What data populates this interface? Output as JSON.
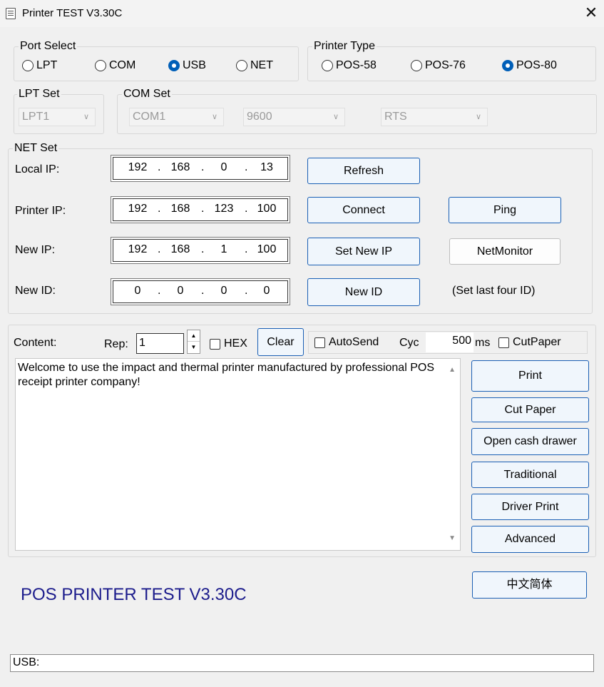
{
  "window": {
    "title": "Printer TEST V3.30C",
    "close": "✕"
  },
  "port_select": {
    "label": "Port Select",
    "options": [
      {
        "label": "LPT",
        "selected": false
      },
      {
        "label": "COM",
        "selected": false
      },
      {
        "label": "USB",
        "selected": true
      },
      {
        "label": "NET",
        "selected": false
      }
    ]
  },
  "printer_type": {
    "label": "Printer Type",
    "options": [
      {
        "label": "POS-58",
        "selected": false
      },
      {
        "label": "POS-76",
        "selected": false
      },
      {
        "label": "POS-80",
        "selected": true
      }
    ]
  },
  "lpt_set": {
    "label": "LPT Set",
    "value": "LPT1"
  },
  "com_set": {
    "label": "COM Set",
    "port": "COM1",
    "baud": "9600",
    "flow": "RTS"
  },
  "net_set": {
    "label": "NET Set",
    "local_ip": {
      "label": "Local IP:",
      "octets": [
        "192",
        "168",
        "0",
        "13"
      ]
    },
    "printer_ip": {
      "label": "Printer IP:",
      "octets": [
        "192",
        "168",
        "123",
        "100"
      ]
    },
    "new_ip": {
      "label": "New IP:",
      "octets": [
        "192",
        "168",
        "1",
        "100"
      ]
    },
    "new_id": {
      "label": "New ID:",
      "octets": [
        "0",
        "0",
        "0",
        "0"
      ]
    },
    "dot": ".",
    "buttons": {
      "refresh": "Refresh",
      "connect": "Connect",
      "ping": "Ping",
      "set_new_ip": "Set New IP",
      "netmonitor": "NetMonitor",
      "new_id": "New ID"
    },
    "hint": "(Set last four ID)"
  },
  "content": {
    "label": "Content:",
    "rep_label": "Rep:",
    "rep_value": "1",
    "hex_label": "HEX",
    "clear_label": "Clear",
    "autosend_label": "AutoSend",
    "cyc_label": "Cyc",
    "cyc_value": "500",
    "ms_label": "ms",
    "cutpaper_label": "CutPaper",
    "text": "Welcome to use the impact and thermal printer manufactured by professional POS receipt printer company!"
  },
  "actions": {
    "print": "Print",
    "cut_paper": "Cut Paper",
    "open_cash_drawer": "Open cash drawer",
    "traditional": "Traditional",
    "driver_print": "Driver Print",
    "advanced": "Advanced",
    "language": "中文简体"
  },
  "app_title": "POS PRINTER TEST V3.30C",
  "status": "USB:",
  "colors": {
    "accent": "#005fb8",
    "button_border": "#1a5fb4",
    "title_text": "#1c1c8c"
  }
}
